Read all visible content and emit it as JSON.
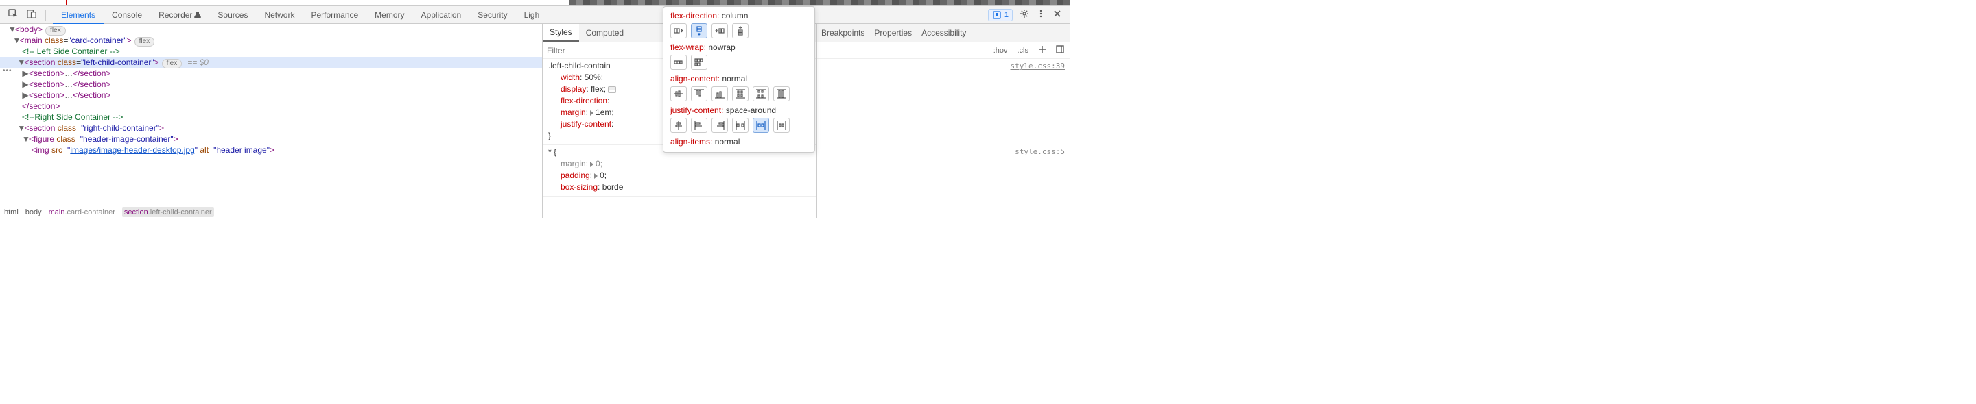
{
  "toolbar": {
    "tabs": {
      "elements": "Elements",
      "console": "Console",
      "recorder": "Recorder",
      "sources": "Sources",
      "network": "Network",
      "performance": "Performance",
      "memory": "Memory",
      "application": "Application",
      "security": "Security",
      "lighthouse": "Ligh"
    },
    "issues_count": "1"
  },
  "dom": {
    "body_open": "<body>",
    "body_pill": "flex",
    "main_open_a": "<main ",
    "main_class_name": "class",
    "main_class_val": "\"card-container\"",
    "main_close": ">",
    "main_pill": "flex",
    "left_comment": "<!-- Left Side Container -->",
    "section_left_a": "<section ",
    "section_left_name": "class",
    "section_left_val": "\"left-child-container\"",
    "section_left_close": ">",
    "section_left_pill": "flex",
    "section_left_ghost": "== $0",
    "section_generic_a": "<section>",
    "section_generic_ell": "…",
    "section_generic_b": "</section>",
    "section_close": "</section>",
    "right_comment": "<!--Right Side Container -->",
    "section_right_a": "<section ",
    "section_right_name": "class",
    "section_right_val": "\"right-child-container\"",
    "section_right_close": ">",
    "figure_a": "<figure ",
    "figure_name": "class",
    "figure_val": "\"header-image-container\"",
    "figure_close": ">",
    "img_a": "<img ",
    "img_src_name": "src",
    "img_src_val_q1": "\"",
    "img_src_val_link": "images/image-header-desktop.jpg",
    "img_src_val_q2": "\"",
    "img_alt_name": "alt",
    "img_alt_val": "\"header image\"",
    "img_close": ">"
  },
  "breadcrumbs": {
    "b0": "html",
    "b1": "body",
    "b2_pre": "main",
    "b2_suf": ".card-container",
    "b3_pre": "section",
    "b3_suf": ".left-child-container"
  },
  "styles": {
    "tab_styles": "Styles",
    "tab_computed": "Computed",
    "filter_placeholder": "Filter",
    "rule1": {
      "origin": "style.css:39",
      "selector": ".left-child-contain",
      "p1n": "width",
      "p1v": "50%",
      "p2n": "display",
      "p2v": "flex",
      "p3n": "flex-direction",
      "p4n": "margin",
      "p4v": "1em",
      "p5n": "justify-content"
    },
    "rule2": {
      "origin": "style.css:5",
      "selector": "*",
      "p1n": "margin",
      "p1v": "0",
      "p2n": "padding",
      "p2v": "0",
      "p3n": "box-sizing",
      "p3v": "borde"
    }
  },
  "side": {
    "tab_breakpoints": "Breakpoints",
    "tab_properties": "Properties",
    "tab_accessibility": "Accessibility",
    "hov": ":hov",
    "cls": ".cls",
    "origin1": "style.css:39",
    "origin2": "style.css:5"
  },
  "flex_popup": {
    "l1": "flex-direction",
    "v1": "column",
    "l2": "flex-wrap",
    "v2": "nowrap",
    "l3": "align-content",
    "v3": "normal",
    "l4": "justify-content",
    "v4": "space-around",
    "l5": "align-items",
    "v5": "normal"
  }
}
